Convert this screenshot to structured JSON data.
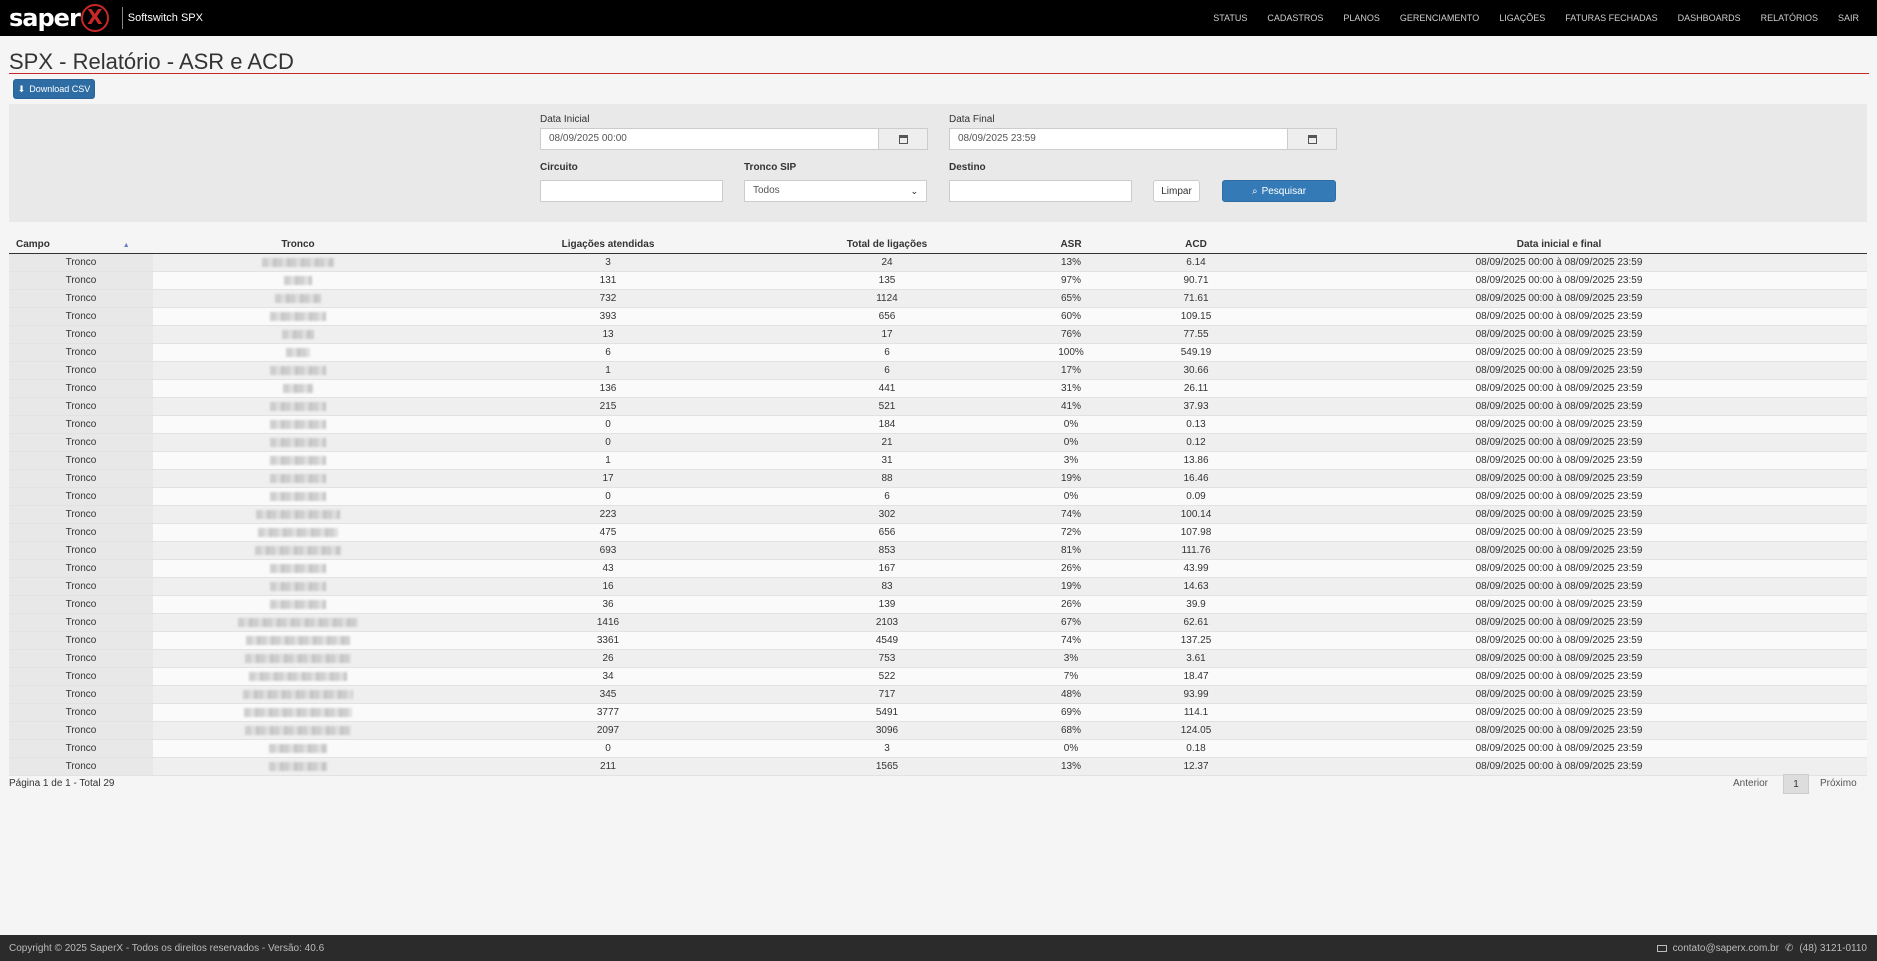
{
  "brand": {
    "logo_text": "saper",
    "logo_mark": "X",
    "subtitle": "Softswitch SPX"
  },
  "nav": [
    "STATUS",
    "CADASTROS",
    "PLANOS",
    "GERENCIAMENTO",
    "LIGAÇÕES",
    "FATURAS FECHADAS",
    "DASHBOARDS",
    "RELATÓRIOS",
    "SAIR"
  ],
  "page": {
    "title": "SPX - Relatório - ASR e ACD",
    "download_label": "Download CSV"
  },
  "filters": {
    "data_inicial_label": "Data Inicial",
    "data_inicial_value": "08/09/2025 00:00",
    "data_final_label": "Data Final",
    "data_final_value": "08/09/2025 23:59",
    "circuito_label": "Circuito",
    "circuito_value": "",
    "tronco_sip_label": "Tronco SIP",
    "tronco_sip_value": "Todos",
    "destino_label": "Destino",
    "destino_value": "",
    "limpar_label": "Limpar",
    "pesquisar_label": "Pesquisar"
  },
  "table": {
    "headers": [
      "Campo",
      "Tronco",
      "Ligações atendidas",
      "Total de ligações",
      "ASR",
      "ACD",
      "Data inicial e final"
    ],
    "rows": [
      {
        "campo": "Tronco",
        "atendidas": "3",
        "total": "24",
        "asr": "13%",
        "acd": "6.14",
        "periodo": "08/09/2025 00:00 à 08/09/2025 23:59"
      },
      {
        "campo": "Tronco",
        "atendidas": "131",
        "total": "135",
        "asr": "97%",
        "acd": "90.71",
        "periodo": "08/09/2025 00:00 à 08/09/2025 23:59"
      },
      {
        "campo": "Tronco",
        "atendidas": "732",
        "total": "1124",
        "asr": "65%",
        "acd": "71.61",
        "periodo": "08/09/2025 00:00 à 08/09/2025 23:59"
      },
      {
        "campo": "Tronco",
        "atendidas": "393",
        "total": "656",
        "asr": "60%",
        "acd": "109.15",
        "periodo": "08/09/2025 00:00 à 08/09/2025 23:59"
      },
      {
        "campo": "Tronco",
        "atendidas": "13",
        "total": "17",
        "asr": "76%",
        "acd": "77.55",
        "periodo": "08/09/2025 00:00 à 08/09/2025 23:59"
      },
      {
        "campo": "Tronco",
        "atendidas": "6",
        "total": "6",
        "asr": "100%",
        "acd": "549.19",
        "periodo": "08/09/2025 00:00 à 08/09/2025 23:59"
      },
      {
        "campo": "Tronco",
        "atendidas": "1",
        "total": "6",
        "asr": "17%",
        "acd": "30.66",
        "periodo": "08/09/2025 00:00 à 08/09/2025 23:59"
      },
      {
        "campo": "Tronco",
        "atendidas": "136",
        "total": "441",
        "asr": "31%",
        "acd": "26.11",
        "periodo": "08/09/2025 00:00 à 08/09/2025 23:59"
      },
      {
        "campo": "Tronco",
        "atendidas": "215",
        "total": "521",
        "asr": "41%",
        "acd": "37.93",
        "periodo": "08/09/2025 00:00 à 08/09/2025 23:59"
      },
      {
        "campo": "Tronco",
        "atendidas": "0",
        "total": "184",
        "asr": "0%",
        "acd": "0.13",
        "periodo": "08/09/2025 00:00 à 08/09/2025 23:59"
      },
      {
        "campo": "Tronco",
        "atendidas": "0",
        "total": "21",
        "asr": "0%",
        "acd": "0.12",
        "periodo": "08/09/2025 00:00 à 08/09/2025 23:59"
      },
      {
        "campo": "Tronco",
        "atendidas": "1",
        "total": "31",
        "asr": "3%",
        "acd": "13.86",
        "periodo": "08/09/2025 00:00 à 08/09/2025 23:59"
      },
      {
        "campo": "Tronco",
        "atendidas": "17",
        "total": "88",
        "asr": "19%",
        "acd": "16.46",
        "periodo": "08/09/2025 00:00 à 08/09/2025 23:59"
      },
      {
        "campo": "Tronco",
        "atendidas": "0",
        "total": "6",
        "asr": "0%",
        "acd": "0.09",
        "periodo": "08/09/2025 00:00 à 08/09/2025 23:59"
      },
      {
        "campo": "Tronco",
        "atendidas": "223",
        "total": "302",
        "asr": "74%",
        "acd": "100.14",
        "periodo": "08/09/2025 00:00 à 08/09/2025 23:59"
      },
      {
        "campo": "Tronco",
        "atendidas": "475",
        "total": "656",
        "asr": "72%",
        "acd": "107.98",
        "periodo": "08/09/2025 00:00 à 08/09/2025 23:59"
      },
      {
        "campo": "Tronco",
        "atendidas": "693",
        "total": "853",
        "asr": "81%",
        "acd": "111.76",
        "periodo": "08/09/2025 00:00 à 08/09/2025 23:59"
      },
      {
        "campo": "Tronco",
        "atendidas": "43",
        "total": "167",
        "asr": "26%",
        "acd": "43.99",
        "periodo": "08/09/2025 00:00 à 08/09/2025 23:59"
      },
      {
        "campo": "Tronco",
        "atendidas": "16",
        "total": "83",
        "asr": "19%",
        "acd": "14.63",
        "periodo": "08/09/2025 00:00 à 08/09/2025 23:59"
      },
      {
        "campo": "Tronco",
        "atendidas": "36",
        "total": "139",
        "asr": "26%",
        "acd": "39.9",
        "periodo": "08/09/2025 00:00 à 08/09/2025 23:59"
      },
      {
        "campo": "Tronco",
        "atendidas": "1416",
        "total": "2103",
        "asr": "67%",
        "acd": "62.61",
        "periodo": "08/09/2025 00:00 à 08/09/2025 23:59"
      },
      {
        "campo": "Tronco",
        "atendidas": "3361",
        "total": "4549",
        "asr": "74%",
        "acd": "137.25",
        "periodo": "08/09/2025 00:00 à 08/09/2025 23:59"
      },
      {
        "campo": "Tronco",
        "atendidas": "26",
        "total": "753",
        "asr": "3%",
        "acd": "3.61",
        "periodo": "08/09/2025 00:00 à 08/09/2025 23:59"
      },
      {
        "campo": "Tronco",
        "atendidas": "34",
        "total": "522",
        "asr": "7%",
        "acd": "18.47",
        "periodo": "08/09/2025 00:00 à 08/09/2025 23:59"
      },
      {
        "campo": "Tronco",
        "atendidas": "345",
        "total": "717",
        "asr": "48%",
        "acd": "93.99",
        "periodo": "08/09/2025 00:00 à 08/09/2025 23:59"
      },
      {
        "campo": "Tronco",
        "atendidas": "3777",
        "total": "5491",
        "asr": "69%",
        "acd": "114.1",
        "periodo": "08/09/2025 00:00 à 08/09/2025 23:59"
      },
      {
        "campo": "Tronco",
        "atendidas": "2097",
        "total": "3096",
        "asr": "68%",
        "acd": "124.05",
        "periodo": "08/09/2025 00:00 à 08/09/2025 23:59"
      },
      {
        "campo": "Tronco",
        "atendidas": "0",
        "total": "3",
        "asr": "0%",
        "acd": "0.18",
        "periodo": "08/09/2025 00:00 à 08/09/2025 23:59"
      },
      {
        "campo": "Tronco",
        "atendidas": "211",
        "total": "1565",
        "asr": "13%",
        "acd": "12.37",
        "periodo": "08/09/2025 00:00 à 08/09/2025 23:59"
      }
    ]
  },
  "pagination": {
    "info": "Página 1 de 1 - Total 29",
    "prev": "Anterior",
    "current": "1",
    "next": "Próximo"
  },
  "footer": {
    "copyright": "Copyright © 2025 SaperX - Todos os direitos reservados - Versão: 40.6",
    "email": "contato@saperx.com.br",
    "phone": "(48) 3121-0110"
  },
  "colors": {
    "navbar": "#000000",
    "accent_red": "#c62828",
    "primary_blue": "#337ab7",
    "footer": "#2b2b2b"
  }
}
